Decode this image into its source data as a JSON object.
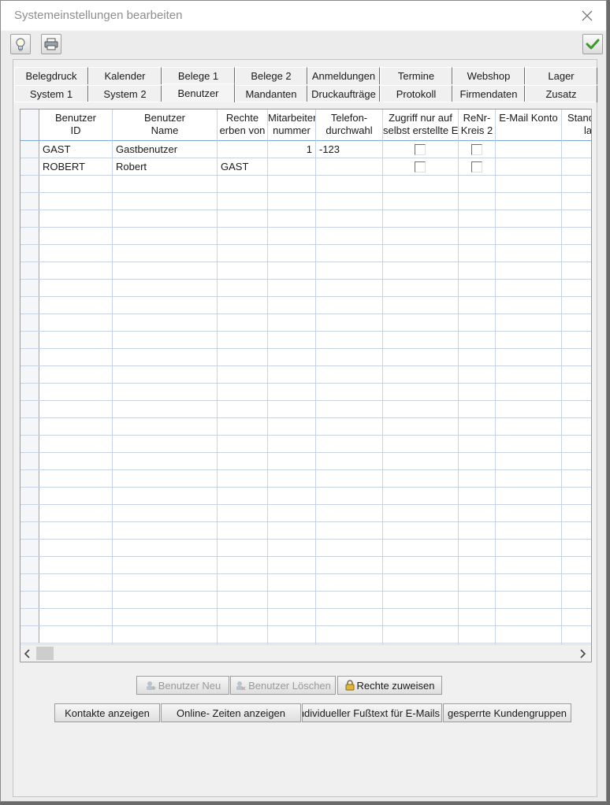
{
  "window": {
    "title": "Systemeinstellungen bearbeiten"
  },
  "toolbar": {
    "left_icons": [
      "lightbulb-icon",
      "printer-icon"
    ],
    "right_icon": "checkmark-icon"
  },
  "tabs_row1": [
    "Belegdruck",
    "Kalender",
    "Belege 1",
    "Belege 2",
    "Anmeldungen",
    "Termine",
    "Webshop",
    "Lager"
  ],
  "tabs_row2": [
    "System 1",
    "System 2",
    "Benutzer",
    "Mandanten",
    "Druckaufträge",
    "Protokoll",
    "Firmendaten",
    "Zusatz"
  ],
  "active_tab": "Benutzer",
  "table": {
    "columns": [
      {
        "line1": "Benutzer",
        "line2": "ID"
      },
      {
        "line1": "Benutzer",
        "line2": "Name"
      },
      {
        "line1": "Rechte",
        "line2": "erben von"
      },
      {
        "line1": "Mitarbeiter",
        "line2": "nummer"
      },
      {
        "line1": "Telefon-",
        "line2": "durchwahl"
      },
      {
        "line1": "Zugriff nur auf",
        "line2": "selbst erstellte E"
      },
      {
        "line1": "ReNr-",
        "line2": "Kreis 2"
      },
      {
        "line1": "E-Mail Konto",
        "line2": ""
      },
      {
        "line1": "Stand",
        "line2": "lag"
      }
    ],
    "rows": [
      {
        "id": "GAST",
        "name": "Gastbenutzer",
        "erben": "",
        "nummer": "1",
        "durchwahl": "-123",
        "zugriff": false,
        "renr": false
      },
      {
        "id": "ROBERT",
        "name": "Robert",
        "erben": "GAST",
        "nummer": "",
        "durchwahl": "",
        "zugriff": false,
        "renr": false
      }
    ]
  },
  "buttons": {
    "benutzer_neu": "Benutzer Neu",
    "benutzer_loeschen": "Benutzer Löschen",
    "rechte_zuweisen": "Rechte zuweisen",
    "kontakte": "Kontakte anzeigen",
    "online_zeiten": "Online- Zeiten anzeigen",
    "fusstext": "Individueller Fußtext für E-Mails",
    "gesperrte": "gesperrte Kundengruppen"
  },
  "colors": {
    "grid_line": "#c6d3e3",
    "header_border": "#7aa6d6",
    "check_green": "#3a9a2a"
  }
}
